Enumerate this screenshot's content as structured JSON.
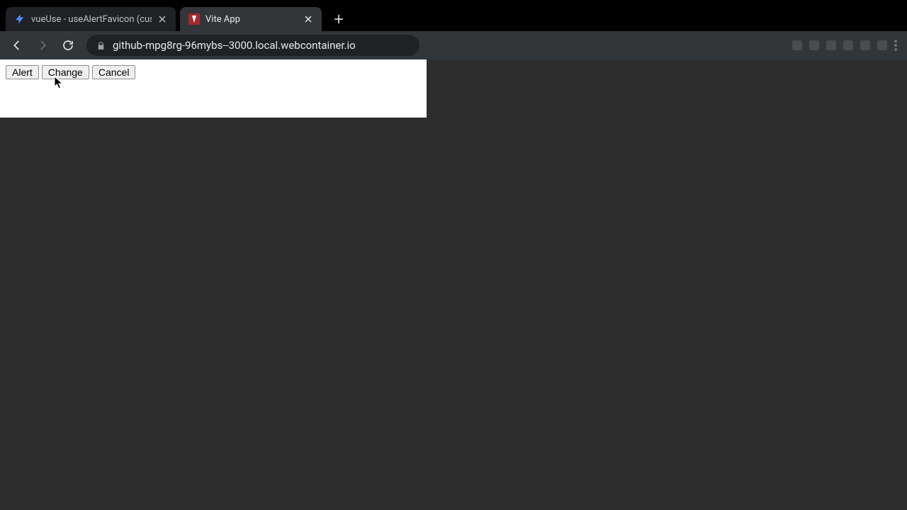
{
  "tabs": [
    {
      "title": "vueUse - useAlertFavicon (cus",
      "favicon": "bolt",
      "active": false
    },
    {
      "title": "Vite App",
      "favicon": "vite",
      "active": true
    }
  ],
  "url": "github-mpg8rg-96mybs--3000.local.webcontainer.io",
  "buttons": {
    "alert": "Alert",
    "change": "Change",
    "cancel": "Cancel"
  }
}
